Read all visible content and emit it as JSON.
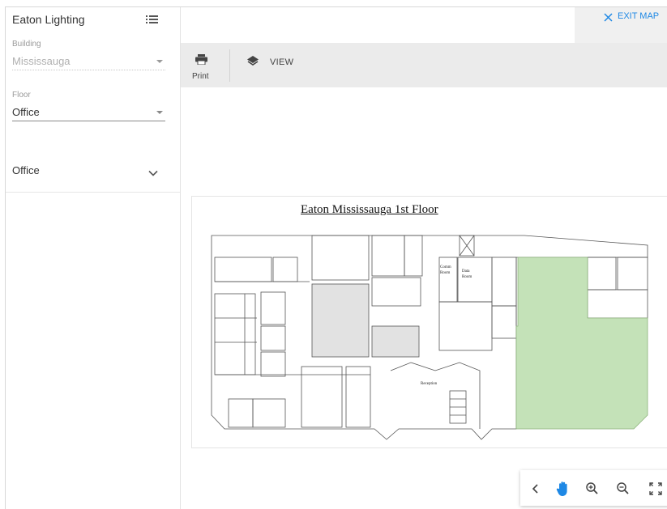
{
  "sidebar": {
    "title": "Eaton Lighting",
    "list_icon": "list-icon",
    "building": {
      "label": "Building",
      "value": "Mississauga"
    },
    "floor": {
      "label": "Floor",
      "value": "Office"
    },
    "section": {
      "label": "Office",
      "icon": "chevron-down-icon"
    }
  },
  "header": {
    "exit_map_label": "EXIT MAP"
  },
  "toolbar": {
    "print_label": "Print",
    "view_label": "VIEW"
  },
  "map": {
    "title": "Eaton Mississauga 1st Floor",
    "room_labels": {
      "comm": "Comm",
      "comm2": "Room",
      "data": "Data",
      "data2": "Room",
      "reception": "Reception"
    },
    "highlight_color": "#c4e2b8",
    "grey_room_color": "#e2e2e2"
  },
  "controls": {
    "back": "chevron-left-icon",
    "pan": "hand-icon",
    "zoom_in": "zoom-in-icon",
    "zoom_out": "zoom-out-icon",
    "fullscreen": "fullscreen-icon"
  },
  "colors": {
    "accent": "#1e88e5"
  }
}
